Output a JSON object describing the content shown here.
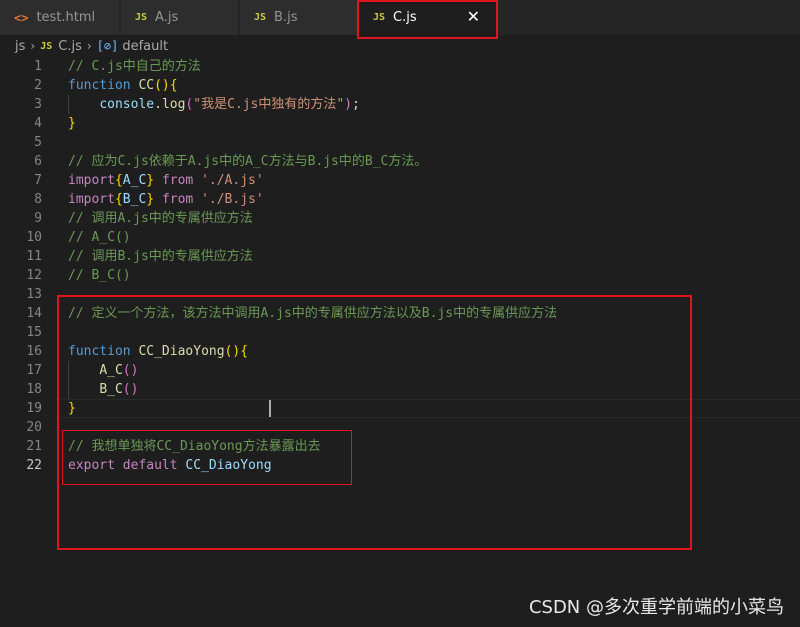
{
  "tabs": [
    {
      "label": "test.html",
      "icon": "html-file-icon",
      "icon_glyph": "<>",
      "active": false
    },
    {
      "label": "A.js",
      "icon": "js-file-icon",
      "icon_glyph": "JS",
      "active": false
    },
    {
      "label": "B.js",
      "icon": "js-file-icon",
      "icon_glyph": "JS",
      "active": false
    },
    {
      "label": "C.js",
      "icon": "js-file-icon",
      "icon_glyph": "JS",
      "active": true,
      "close_glyph": "✕"
    }
  ],
  "breadcrumb": {
    "folder": "js",
    "file": "C.js",
    "file_icon_glyph": "JS",
    "symbol": "default",
    "symbol_icon_glyph": "[⊘]",
    "separator": "›"
  },
  "editor": {
    "line_numbers": [
      "1",
      "2",
      "3",
      "4",
      "5",
      "6",
      "7",
      "8",
      "9",
      "10",
      "11",
      "12",
      "13",
      "14",
      "15",
      "16",
      "17",
      "18",
      "19",
      "20",
      "21",
      "22"
    ],
    "current_line": "22",
    "lines": [
      [
        [
          "comment",
          "// C.js中自己的方法"
        ]
      ],
      [
        [
          "kw",
          "function"
        ],
        [
          "plain",
          " "
        ],
        [
          "fn",
          "CC"
        ],
        [
          "b1",
          "()"
        ],
        [
          "b1",
          "{"
        ]
      ],
      [
        [
          "plain",
          "    "
        ],
        [
          "var",
          "console"
        ],
        [
          "plain",
          "."
        ],
        [
          "fn",
          "log"
        ],
        [
          "b2",
          "("
        ],
        [
          "str",
          "\"我是C.js中独有的方法\""
        ],
        [
          "b2",
          ")"
        ],
        [
          "plain",
          ";"
        ]
      ],
      [
        [
          "b1",
          "}"
        ]
      ],
      [],
      [
        [
          "comment",
          "// 应为C.js依赖于A.js中的A_C方法与B.js中的B_C方法。"
        ]
      ],
      [
        [
          "kw2",
          "import"
        ],
        [
          "b1",
          "{"
        ],
        [
          "var",
          "A_C"
        ],
        [
          "b1",
          "}"
        ],
        [
          "plain",
          " "
        ],
        [
          "kw2",
          "from"
        ],
        [
          "plain",
          " "
        ],
        [
          "str",
          "'./A.js'"
        ]
      ],
      [
        [
          "kw2",
          "import"
        ],
        [
          "b1",
          "{"
        ],
        [
          "var",
          "B_C"
        ],
        [
          "b1",
          "}"
        ],
        [
          "plain",
          " "
        ],
        [
          "kw2",
          "from"
        ],
        [
          "plain",
          " "
        ],
        [
          "str",
          "'./B.js'"
        ]
      ],
      [
        [
          "comment",
          "// 调用A.js中的专属供应方法"
        ]
      ],
      [
        [
          "comment",
          "// A_C()"
        ]
      ],
      [
        [
          "comment",
          "// 调用B.js中的专属供应方法"
        ]
      ],
      [
        [
          "comment",
          "// B_C()"
        ]
      ],
      [],
      [
        [
          "comment",
          "// 定义一个方法，该方法中调用A.js中的专属供应方法以及B.js中的专属供应方法"
        ]
      ],
      [],
      [
        [
          "kw",
          "function"
        ],
        [
          "plain",
          " "
        ],
        [
          "fn",
          "CC_DiaoYong"
        ],
        [
          "b1",
          "()"
        ],
        [
          "b1",
          "{"
        ]
      ],
      [
        [
          "plain",
          "    "
        ],
        [
          "fn",
          "A_C"
        ],
        [
          "b2",
          "()"
        ]
      ],
      [
        [
          "plain",
          "    "
        ],
        [
          "fn",
          "B_C"
        ],
        [
          "b2",
          "()"
        ]
      ],
      [
        [
          "b1",
          "}"
        ]
      ],
      [],
      [
        [
          "comment",
          "// 我想单独将CC_DiaoYong方法暴露出去"
        ]
      ],
      [
        [
          "kw2",
          "export"
        ],
        [
          "plain",
          " "
        ],
        [
          "kw2",
          "default"
        ],
        [
          "plain",
          " "
        ],
        [
          "var",
          "CC_DiaoYong"
        ]
      ]
    ]
  },
  "watermark": "CSDN @多次重学前端的小菜鸟",
  "colors": {
    "annotation_red": "#e0151f",
    "comment_green": "#6a9955",
    "keyword_blue": "#569cd6",
    "keyword_purple": "#c586c0",
    "function_yellow": "#dcdcaa",
    "string_orange": "#ce9178",
    "variable_lightblue": "#9cdcfe"
  }
}
